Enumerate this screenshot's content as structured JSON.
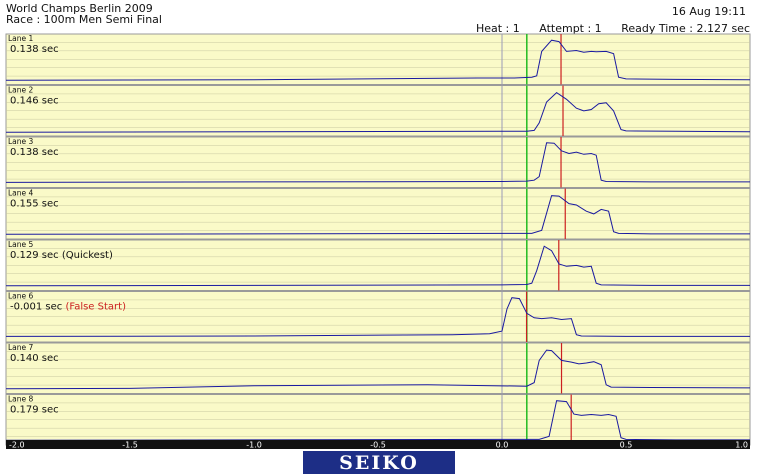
{
  "header": {
    "title": "World Champs Berlin 2009",
    "race": "Race : 100m Men Semi Final",
    "datetime": "16 Aug 19:11",
    "heat": "Heat : 1",
    "attempt": "Attempt : 1",
    "ready_time": "Ready Time : 2.127 sec"
  },
  "logo": {
    "text": "SEIKO",
    "color": "#1d2e86"
  },
  "colors": {
    "panel_bg": "#fafac8",
    "grid": "#c8c8a0",
    "signal": "#1a1aa0",
    "reaction_marker": "#cc2020",
    "start_marker": "#22bb22",
    "zero_line": "#9a9ab8",
    "axis_bar": "#111111",
    "false_start_text": "#cc2020"
  },
  "chart_data": {
    "type": "line",
    "title": "",
    "xlabel": "",
    "ylabel": "",
    "xlim": [
      -2.0,
      1.0
    ],
    "x_ticks": [
      -2.0,
      -1.5,
      -1.0,
      -0.5,
      0.0,
      0.5,
      1.0
    ],
    "x_tick_labels": [
      "-2.0",
      "-1.5",
      "-1.0",
      "-0.5",
      "0.0",
      "0.5",
      "1.0"
    ],
    "start_signal_x": 0.1,
    "grid": true,
    "lanes": [
      {
        "name": "Lane 1",
        "reaction_label": "0.138 sec",
        "note": "",
        "reaction": 0.138,
        "series": {
          "x": [
            -2.0,
            -1.0,
            -0.1,
            0.05,
            0.12,
            0.14,
            0.16,
            0.2,
            0.23,
            0.26,
            0.3,
            0.33,
            0.36,
            0.38,
            0.42,
            0.45,
            0.47,
            0.5,
            0.7,
            1.0
          ],
          "y": [
            0.05,
            0.06,
            0.1,
            0.1,
            0.12,
            0.15,
            0.7,
            0.95,
            0.92,
            0.7,
            0.72,
            0.68,
            0.7,
            0.69,
            0.7,
            0.65,
            0.12,
            0.08,
            0.07,
            0.06
          ]
        }
      },
      {
        "name": "Lane 2",
        "reaction_label": "0.146 sec",
        "note": "",
        "reaction": 0.146,
        "series": {
          "x": [
            -2.0,
            -1.0,
            0.0,
            0.1,
            0.13,
            0.15,
            0.18,
            0.22,
            0.26,
            0.3,
            0.33,
            0.36,
            0.39,
            0.42,
            0.45,
            0.48,
            0.5,
            0.7,
            1.0
          ],
          "y": [
            0.04,
            0.05,
            0.06,
            0.06,
            0.08,
            0.25,
            0.72,
            0.93,
            0.78,
            0.58,
            0.52,
            0.55,
            0.68,
            0.7,
            0.52,
            0.1,
            0.07,
            0.06,
            0.05
          ]
        }
      },
      {
        "name": "Lane 3",
        "reaction_label": "0.138 sec",
        "note": "",
        "reaction": 0.138,
        "series": {
          "x": [
            -2.0,
            -1.0,
            0.0,
            0.1,
            0.13,
            0.15,
            0.18,
            0.21,
            0.24,
            0.27,
            0.3,
            0.33,
            0.36,
            0.38,
            0.4,
            0.42,
            0.6,
            1.0
          ],
          "y": [
            0.07,
            0.08,
            0.09,
            0.1,
            0.12,
            0.2,
            0.96,
            0.95,
            0.78,
            0.72,
            0.75,
            0.7,
            0.72,
            0.68,
            0.12,
            0.09,
            0.08,
            0.08
          ]
        }
      },
      {
        "name": "Lane 4",
        "reaction_label": "0.155 sec",
        "note": "",
        "reaction": 0.155,
        "series": {
          "x": [
            -2.0,
            -1.0,
            0.0,
            0.12,
            0.16,
            0.2,
            0.23,
            0.27,
            0.3,
            0.34,
            0.37,
            0.4,
            0.43,
            0.45,
            0.47,
            0.6,
            1.0
          ],
          "y": [
            0.06,
            0.07,
            0.08,
            0.08,
            0.15,
            0.93,
            0.92,
            0.75,
            0.72,
            0.58,
            0.52,
            0.62,
            0.58,
            0.12,
            0.08,
            0.07,
            0.07
          ]
        }
      },
      {
        "name": "Lane 5",
        "reaction_label": "0.129 sec",
        "note": "(Quickest)",
        "reaction": 0.129,
        "series": {
          "x": [
            -2.0,
            -1.0,
            0.0,
            0.1,
            0.12,
            0.14,
            0.17,
            0.2,
            0.23,
            0.26,
            0.3,
            0.33,
            0.36,
            0.38,
            0.4,
            0.6,
            1.0
          ],
          "y": [
            0.06,
            0.07,
            0.08,
            0.09,
            0.12,
            0.4,
            0.95,
            0.85,
            0.55,
            0.5,
            0.52,
            0.48,
            0.5,
            0.12,
            0.08,
            0.07,
            0.07
          ]
        }
      },
      {
        "name": "Lane 6",
        "reaction_label": "-0.001 sec",
        "note": "(False Start)",
        "reaction": -0.001,
        "series": {
          "x": [
            -2.0,
            -1.0,
            -0.2,
            -0.05,
            0.0,
            0.02,
            0.04,
            0.07,
            0.1,
            0.13,
            0.16,
            0.2,
            0.24,
            0.28,
            0.3,
            0.32,
            0.5,
            1.0
          ],
          "y": [
            0.08,
            0.09,
            0.12,
            0.14,
            0.2,
            0.7,
            0.95,
            0.93,
            0.6,
            0.5,
            0.48,
            0.5,
            0.46,
            0.48,
            0.12,
            0.09,
            0.08,
            0.08
          ]
        }
      },
      {
        "name": "Lane 7",
        "reaction_label": "0.140 sec",
        "note": "",
        "reaction": 0.14,
        "series": {
          "x": [
            -2.0,
            -1.5,
            -1.0,
            -0.3,
            0.1,
            0.13,
            0.15,
            0.18,
            0.2,
            0.24,
            0.28,
            0.31,
            0.34,
            0.37,
            0.4,
            0.42,
            0.44,
            0.6,
            1.0
          ],
          "y": [
            0.06,
            0.07,
            0.13,
            0.15,
            0.12,
            0.2,
            0.7,
            0.93,
            0.92,
            0.7,
            0.66,
            0.62,
            0.64,
            0.67,
            0.6,
            0.15,
            0.1,
            0.09,
            0.08
          ]
        }
      },
      {
        "name": "Lane 8",
        "reaction_label": "0.179 sec",
        "note": "",
        "reaction": 0.179,
        "series": {
          "x": [
            -2.0,
            -1.0,
            0.0,
            0.15,
            0.19,
            0.22,
            0.26,
            0.29,
            0.32,
            0.36,
            0.4,
            0.43,
            0.46,
            0.48,
            0.5,
            0.7,
            1.0
          ],
          "y": [
            0.06,
            0.07,
            0.08,
            0.08,
            0.15,
            0.95,
            0.93,
            0.65,
            0.62,
            0.64,
            0.62,
            0.64,
            0.6,
            0.12,
            0.08,
            0.07,
            0.07
          ]
        }
      }
    ]
  }
}
